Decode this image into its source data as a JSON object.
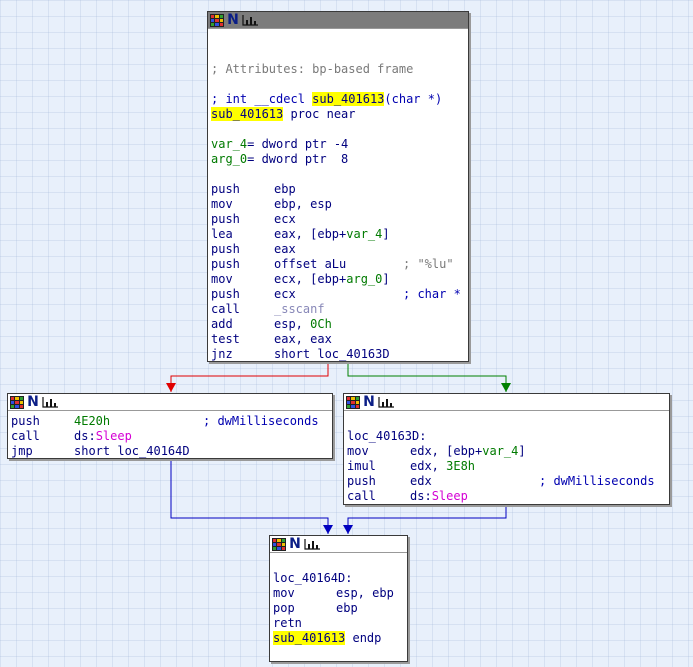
{
  "colors": {
    "edge_false": "#e00000",
    "edge_true": "#008000",
    "edge_uncond": "#0000c0",
    "highlight": "#ffff00"
  },
  "icons": [
    "graph-icon",
    "n-icon",
    "chart-icon"
  ],
  "nodes": {
    "entry": {
      "attrs": "; Attributes: bp-based frame",
      "sig_prefix": "; int __cdecl ",
      "sig_name": "sub_401613",
      "sig_suffix": "(char *)",
      "proc_name": "sub_401613",
      "proc_suffix": " proc near",
      "var4_name": "var_4",
      "var4_rest": "= dword ptr -4",
      "arg0_name": "arg_0",
      "arg0_rest": "= dword ptr  8",
      "i1_m": "push",
      "i1_o": "ebp",
      "i2_m": "mov",
      "i2_o": "ebp, esp",
      "i3_m": "push",
      "i3_o": "ecx",
      "i4_m": "lea",
      "i4_o1": "eax, [ebp+",
      "i4_o2": "var_4",
      "i4_o3": "]",
      "i5_m": "push",
      "i5_o": "eax",
      "i6_m": "push",
      "i6_o": "offset aLu",
      "i6_c": "; \"%lu\"",
      "i7_m": "mov",
      "i7_o1": "ecx, [ebp+",
      "i7_o2": "arg_0",
      "i7_o3": "]",
      "i8_m": "push",
      "i8_o": "ecx",
      "i8_c": "; char *",
      "i9_m": "call",
      "i9_o": "_sscanf",
      "i10_m": "add",
      "i10_o1": "esp, ",
      "i10_o2": "0Ch",
      "i11_m": "test",
      "i11_o": "eax, eax",
      "i12_m": "jnz",
      "i12_o": "short loc_40163D"
    },
    "left": {
      "i1_m": "push",
      "i1_o": "4E20h",
      "i1_c": "; dwMilliseconds",
      "i2_m": "call",
      "i2_o1": "ds:",
      "i2_o2": "Sleep",
      "i3_m": "jmp",
      "i3_o": "short loc_40164D"
    },
    "right": {
      "label": "loc_40163D:",
      "i1_m": "mov",
      "i1_o1": "edx, [ebp+",
      "i1_o2": "var_4",
      "i1_o3": "]",
      "i2_m": "imul",
      "i2_o1": "edx, ",
      "i2_o2": "3E8h",
      "i3_m": "push",
      "i3_o": "edx",
      "i3_c": "; dwMilliseconds",
      "i4_m": "call",
      "i4_o1": "ds:",
      "i4_o2": "Sleep"
    },
    "exit": {
      "label": "loc_40164D:",
      "i1_m": "mov",
      "i1_o": "esp, ebp",
      "i2_m": "pop",
      "i2_o": "ebp",
      "i3_m": "retn",
      "endp_name": "sub_401613",
      "endp_suffix": " endp"
    }
  }
}
